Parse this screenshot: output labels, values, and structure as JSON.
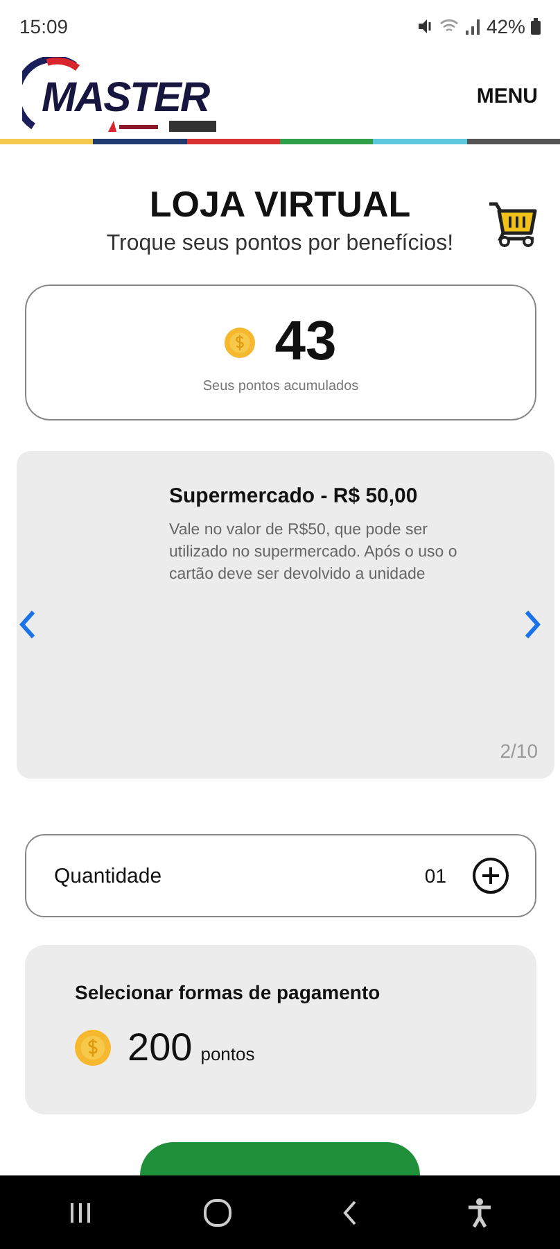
{
  "status_bar": {
    "time": "15:09",
    "battery": "42%"
  },
  "header": {
    "logo_text": "MASTER",
    "menu": "MENU"
  },
  "title": "LOJA VIRTUAL",
  "subtitle": "Troque seus pontos por benefícios!",
  "points": {
    "value": "43",
    "label": "Seus pontos acumulados"
  },
  "product": {
    "title": "Supermercado - R$ 50,00",
    "description": "Vale no valor de R$50, que pode ser utilizado no supermercado. Após o uso o cartão deve ser devolvido a unidade",
    "counter": "2/10"
  },
  "quantity": {
    "label": "Quantidade",
    "value": "01"
  },
  "payment": {
    "title": "Selecionar formas de pagamento",
    "amount": "200",
    "unit": "pontos"
  }
}
